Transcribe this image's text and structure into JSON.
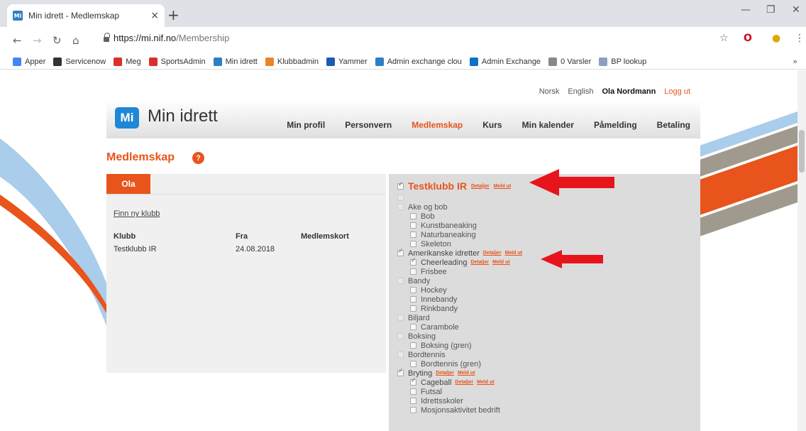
{
  "browser": {
    "tab_title": "Min idrett - Medlemskap",
    "tab_favicon": "Mi",
    "tab_close": "×",
    "new_tab": "+",
    "url_host": "https://mi.nif.no",
    "url_path": "/Membership",
    "bookmarks": [
      {
        "label": "Apper",
        "icon": "apps-grid-icon",
        "color": "#4285f4"
      },
      {
        "label": "Servicenow",
        "icon": "servicenow-icon",
        "color": "#333333"
      },
      {
        "label": "Meg",
        "icon": "sa-icon",
        "color": "#d9312a"
      },
      {
        "label": "SportsAdmin",
        "icon": "sa-icon",
        "color": "#d9312a"
      },
      {
        "label": "Min idrett",
        "icon": "mi-icon",
        "color": "#2d7fc4"
      },
      {
        "label": "Klubbadmin",
        "icon": "ka-icon",
        "color": "#e8852b"
      },
      {
        "label": "Yammer",
        "icon": "yammer-icon",
        "color": "#1b5cb3"
      },
      {
        "label": "Admin exchange clou",
        "icon": "exchange-icon",
        "color": "#2d7fc4"
      },
      {
        "label": "Admin Exchange",
        "icon": "outlook-icon",
        "color": "#0e6fc7"
      },
      {
        "label": "0 Varsler",
        "icon": "page-icon",
        "color": "#888888"
      },
      {
        "label": "BP lookup",
        "icon": "doc-icon",
        "color": "#8aa0c0"
      }
    ],
    "bookmarks_more": "»"
  },
  "site": {
    "lang_no": "Norsk",
    "lang_en": "English",
    "user_name": "Ola Nordmann",
    "logout": "Logg ut",
    "logo_mark": "Mi",
    "logo_text": "Min idrett",
    "nav": [
      "Min profil",
      "Personvern",
      "Medlemskap",
      "Kurs",
      "Min kalender",
      "Påmelding",
      "Betaling"
    ],
    "active_nav": "Medlemskap",
    "page_title": "Medlemskap",
    "help": "?",
    "accent_color": "#e8541b"
  },
  "left": {
    "person_tab": "Ola",
    "find_club": "Finn ny klubb",
    "columns": [
      "Klubb",
      "Fra",
      "Medlemskort"
    ],
    "rows": [
      [
        "Testklubb IR",
        "24.08.2018",
        ""
      ]
    ]
  },
  "tree": {
    "root": {
      "label": "Testklubb IR",
      "details": "Detaljer",
      "leave": "Meld ut"
    },
    "nodes": [
      {
        "label": "",
        "level": 1,
        "checked": false,
        "faint": true
      },
      {
        "label": "Ake og bob",
        "level": 1,
        "checked": false,
        "faint": true
      },
      {
        "label": "Bob",
        "level": 2,
        "checked": false
      },
      {
        "label": "Kunstbaneaking",
        "level": 2,
        "checked": false
      },
      {
        "label": "Naturbaneaking",
        "level": 2,
        "checked": false
      },
      {
        "label": "Skeleton",
        "level": 2,
        "checked": false
      },
      {
        "label": "Amerikanske idretter",
        "level": 1,
        "checked": true,
        "links": true
      },
      {
        "label": "Cheerleading",
        "level": 2,
        "checked": true,
        "links": true
      },
      {
        "label": "Frisbee",
        "level": 2,
        "checked": false
      },
      {
        "label": "Bandy",
        "level": 1,
        "checked": false,
        "faint": true
      },
      {
        "label": "Hockey",
        "level": 2,
        "checked": false
      },
      {
        "label": "Innebandy",
        "level": 2,
        "checked": false
      },
      {
        "label": "Rinkbandy",
        "level": 2,
        "checked": false
      },
      {
        "label": "Biljard",
        "level": 1,
        "checked": false,
        "faint": true
      },
      {
        "label": "Carambole",
        "level": 2,
        "checked": false
      },
      {
        "label": "Boksing",
        "level": 1,
        "checked": false,
        "faint": true
      },
      {
        "label": "Boksing (gren)",
        "level": 2,
        "checked": false
      },
      {
        "label": "Bordtennis",
        "level": 1,
        "checked": false,
        "faint": true
      },
      {
        "label": "Bordtennis (gren)",
        "level": 2,
        "checked": false
      },
      {
        "label": "Bryting",
        "level": 1,
        "checked": true,
        "links": true
      },
      {
        "label": "Cageball",
        "level": 2,
        "checked": true,
        "links": true
      },
      {
        "label": "Futsal",
        "level": 2,
        "checked": false
      },
      {
        "label": "Idrettsskoler",
        "level": 2,
        "checked": false
      },
      {
        "label": "Mosjonsaktivitet bedrift",
        "level": 2,
        "checked": false
      }
    ],
    "details_label": "Detaljer",
    "leave_label": "Meld ut"
  }
}
